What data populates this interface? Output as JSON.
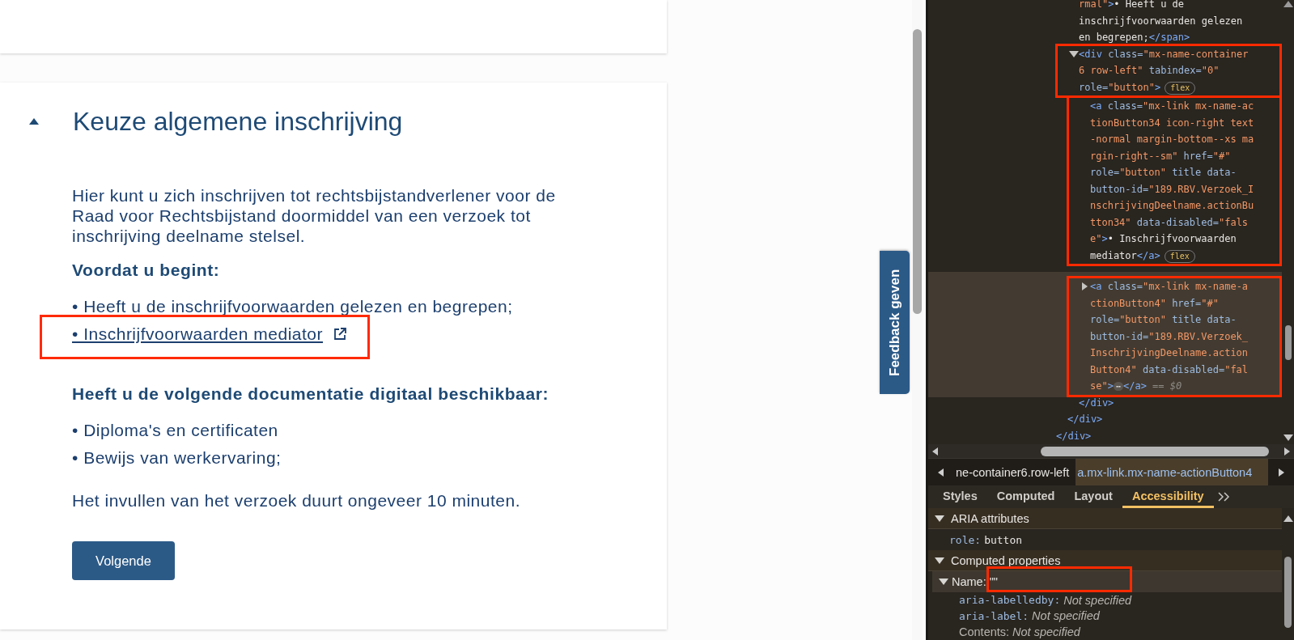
{
  "page": {
    "section": {
      "title": "Keuze algemene inschrijving",
      "expanded": true,
      "intro": "Hier kunt u zich inschrijven tot rechtsbijstandverlener voor de Raad voor Rechtsbijstand doormiddel van een verzoek tot inschrijving deelname stelsel.",
      "blocks": [
        {
          "heading": "Voordat u begint:",
          "items": [
            {
              "kind": "text",
              "text": "• Heeft u de inschrijfvoorwaarden gelezen en begrepen;",
              "highlighted": false
            },
            {
              "kind": "link",
              "text": "• Inschrijfvoorwaarden mediator",
              "highlighted": true
            }
          ]
        },
        {
          "heading": "Heeft u de volgende documentatie digitaal beschikbaar:",
          "items": [
            {
              "kind": "text",
              "text": "• Diploma's en certificaten",
              "highlighted": false
            },
            {
              "kind": "text",
              "text": "• Bewijs van werkervaring;",
              "highlighted": false
            }
          ]
        }
      ],
      "note": "Het invullen van het verzoek duurt ongeveer 10 minuten.",
      "button": "Volgende"
    },
    "feedback_tab": "Feedback geven"
  },
  "devtools": {
    "dom_tree": [
      {
        "closing": [
          {
            "kind": "tag",
            "text": "</div>"
          }
        ],
        "children": [
          {
            "closing": [
              {
                "kind": "tag",
                "text": "</div>"
              }
            ],
            "children": [
              {
                "selected": false,
                "highlighted": false,
                "lines": [
                  [
                    {
                      "kind": "val",
                      "text": "rmal\""
                    },
                    {
                      "kind": "tag",
                      "text": ">"
                    },
                    {
                      "kind": "text",
                      "text": "• Heeft u de"
                    }
                  ],
                  [
                    {
                      "kind": "text",
                      "text": "inschrijfvoorwaarden gelezen"
                    }
                  ],
                  [
                    {
                      "kind": "text",
                      "text": "en begrepen;"
                    },
                    {
                      "kind": "tag",
                      "text": "</span>"
                    }
                  ]
                ]
              },
              {
                "selected": false,
                "highlighted": true,
                "expanded": true,
                "lines": [
                  [
                    {
                      "kind": "tag",
                      "text": "<div"
                    },
                    {
                      "kind": "attr",
                      "text": " class="
                    },
                    {
                      "kind": "val",
                      "text": "\"mx-name-container"
                    }
                  ],
                  [
                    {
                      "kind": "val",
                      "text": "6 row-left\""
                    },
                    {
                      "kind": "attr",
                      "text": " tabindex="
                    },
                    {
                      "kind": "val",
                      "text": "\"0\""
                    }
                  ],
                  [
                    {
                      "kind": "attr",
                      "text": "role="
                    },
                    {
                      "kind": "val",
                      "text": "\"button\""
                    },
                    {
                      "kind": "tag",
                      "text": ">"
                    },
                    {
                      "kind": "badge",
                      "text": "flex"
                    }
                  ]
                ],
                "closing": [
                  {
                    "kind": "tag",
                    "text": "</div>"
                  }
                ],
                "children": [
                  {
                    "selected": false,
                    "highlighted": true,
                    "lines": [
                      [
                        {
                          "kind": "tag",
                          "text": "<a"
                        },
                        {
                          "kind": "attr",
                          "text": " class="
                        },
                        {
                          "kind": "val",
                          "text": "\"mx-link mx-name-ac"
                        }
                      ],
                      [
                        {
                          "kind": "val",
                          "text": "tionButton34 icon-right text"
                        }
                      ],
                      [
                        {
                          "kind": "val",
                          "text": "-normal margin-bottom--xs ma"
                        }
                      ],
                      [
                        {
                          "kind": "val",
                          "text": "rgin-right--sm\""
                        },
                        {
                          "kind": "attr",
                          "text": " href="
                        },
                        {
                          "kind": "val",
                          "text": "\"#\""
                        }
                      ],
                      [
                        {
                          "kind": "attr",
                          "text": "role="
                        },
                        {
                          "kind": "val",
                          "text": "\"button\""
                        },
                        {
                          "kind": "attr",
                          "text": " title data-"
                        }
                      ],
                      [
                        {
                          "kind": "attr",
                          "text": "button-id="
                        },
                        {
                          "kind": "val",
                          "text": "\"189.RBV.Verzoek_I"
                        }
                      ],
                      [
                        {
                          "kind": "val",
                          "text": "nschrijvingDeelname.actionBu"
                        }
                      ],
                      [
                        {
                          "kind": "val",
                          "text": "tton34\""
                        },
                        {
                          "kind": "attr",
                          "text": " data-disabled="
                        },
                        {
                          "kind": "val",
                          "text": "\"fals"
                        }
                      ],
                      [
                        {
                          "kind": "val",
                          "text": "e\""
                        },
                        {
                          "kind": "tag",
                          "text": ">"
                        },
                        {
                          "kind": "text",
                          "text": "• Inschrijfvoorwaarden"
                        }
                      ],
                      [
                        {
                          "kind": "text",
                          "text": "mediator"
                        },
                        {
                          "kind": "tag",
                          "text": "</a>"
                        },
                        {
                          "kind": "badge",
                          "text": "flex"
                        }
                      ]
                    ]
                  },
                  {
                    "selected": true,
                    "highlighted": true,
                    "expanded": false,
                    "lines": [
                      [
                        {
                          "kind": "tag",
                          "text": "<a"
                        },
                        {
                          "kind": "attr",
                          "text": " class="
                        },
                        {
                          "kind": "val",
                          "text": "\"mx-link mx-name-a"
                        }
                      ],
                      [
                        {
                          "kind": "val",
                          "text": "ctionButton4\""
                        },
                        {
                          "kind": "attr",
                          "text": " href="
                        },
                        {
                          "kind": "val",
                          "text": "\"#\""
                        }
                      ],
                      [
                        {
                          "kind": "attr",
                          "text": "role="
                        },
                        {
                          "kind": "val",
                          "text": "\"button\""
                        },
                        {
                          "kind": "attr",
                          "text": " title data-"
                        }
                      ],
                      [
                        {
                          "kind": "attr",
                          "text": "button-id="
                        },
                        {
                          "kind": "val",
                          "text": "\"189.RBV.Verzoek_"
                        }
                      ],
                      [
                        {
                          "kind": "val",
                          "text": "InschrijvingDeelname.action"
                        }
                      ],
                      [
                        {
                          "kind": "val",
                          "text": "Button4\""
                        },
                        {
                          "kind": "attr",
                          "text": " data-disabled="
                        },
                        {
                          "kind": "val",
                          "text": "\"fal"
                        }
                      ],
                      [
                        {
                          "kind": "val",
                          "text": "se\""
                        },
                        {
                          "kind": "tag",
                          "text": ">"
                        },
                        {
                          "kind": "more",
                          "text": "⋯"
                        },
                        {
                          "kind": "tag",
                          "text": "</a>"
                        },
                        {
                          "kind": "dim",
                          "text": " == $0"
                        }
                      ]
                    ]
                  }
                ]
              }
            ]
          }
        ]
      }
    ],
    "breadcrumbs": [
      {
        "text": "ne-container6.row-left",
        "selected": false
      },
      {
        "text": "a.mx-link.mx-name-actionButton4",
        "selected": true
      }
    ],
    "tabs": [
      {
        "label": "Styles",
        "selected": false
      },
      {
        "label": "Computed",
        "selected": false
      },
      {
        "label": "Layout",
        "selected": false
      },
      {
        "label": "Accessibility",
        "selected": true
      }
    ],
    "sections": [
      {
        "title": "ARIA attributes",
        "expanded": true,
        "rows": [
          {
            "kind": "code",
            "key": "role:",
            "value": "button",
            "highlighted": false
          }
        ]
      },
      {
        "title": "Computed properties",
        "expanded": true,
        "rows": [
          {
            "kind": "tree",
            "key": "Name:",
            "value": "\"\"",
            "expanded": true,
            "highlighted": true,
            "children": [
              {
                "kind": "code",
                "key": "aria-labelledby:",
                "value": "Not specified"
              },
              {
                "kind": "code",
                "key": "aria-label:",
                "value": "Not specified"
              },
              {
                "kind": "plain",
                "key": "Contents:",
                "value": "Not specified"
              }
            ]
          }
        ]
      }
    ]
  }
}
